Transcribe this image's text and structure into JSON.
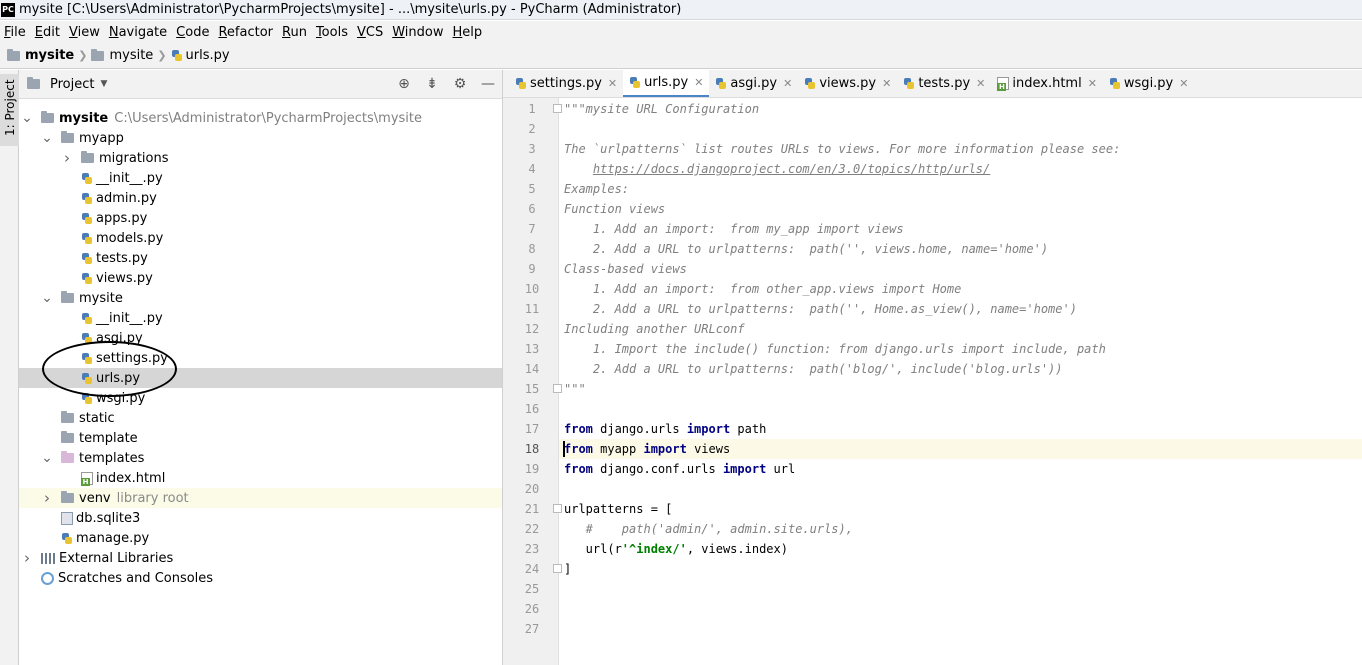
{
  "window": {
    "title": "mysite [C:\\Users\\Administrator\\PycharmProjects\\mysite] - ...\\mysite\\urls.py - PyCharm (Administrator)",
    "logo": "PC"
  },
  "menu": [
    "File",
    "Edit",
    "View",
    "Navigate",
    "Code",
    "Refactor",
    "Run",
    "Tools",
    "VCS",
    "Window",
    "Help"
  ],
  "breadcrumb": [
    "mysite",
    "mysite",
    "urls.py"
  ],
  "toolstrip": {
    "project_tab": "1: Project"
  },
  "project_panel": {
    "title": "Project",
    "tree": [
      {
        "label": "mysite",
        "hint": "C:\\Users\\Administrator\\PycharmProjects\\mysite",
        "bold": true,
        "depth": 0,
        "kind": "folder",
        "expanded": true
      },
      {
        "label": "myapp",
        "depth": 1,
        "kind": "folder",
        "expanded": true
      },
      {
        "label": "migrations",
        "depth": 2,
        "kind": "folder",
        "expanded": false
      },
      {
        "label": "__init__.py",
        "depth": 3,
        "kind": "py"
      },
      {
        "label": "admin.py",
        "depth": 3,
        "kind": "py"
      },
      {
        "label": "apps.py",
        "depth": 3,
        "kind": "py"
      },
      {
        "label": "models.py",
        "depth": 3,
        "kind": "py"
      },
      {
        "label": "tests.py",
        "depth": 3,
        "kind": "py"
      },
      {
        "label": "views.py",
        "depth": 3,
        "kind": "py"
      },
      {
        "label": "mysite",
        "depth": 1,
        "kind": "folder",
        "expanded": true
      },
      {
        "label": "__init__.py",
        "depth": 3,
        "kind": "py"
      },
      {
        "label": "asgi.py",
        "depth": 3,
        "kind": "py"
      },
      {
        "label": "settings.py",
        "depth": 3,
        "kind": "py"
      },
      {
        "label": "urls.py",
        "depth": 3,
        "kind": "py",
        "selected": true
      },
      {
        "label": "wsgi.py",
        "depth": 3,
        "kind": "py"
      },
      {
        "label": "static",
        "depth": 2,
        "kind": "folder"
      },
      {
        "label": "template",
        "depth": 2,
        "kind": "folder"
      },
      {
        "label": "templates",
        "depth": 1,
        "kind": "folder-pink",
        "expanded": true
      },
      {
        "label": "index.html",
        "depth": 3,
        "kind": "html"
      },
      {
        "label": "venv",
        "hint": "library root",
        "depth": 1,
        "kind": "folder",
        "expanded": false,
        "venv": true
      },
      {
        "label": "db.sqlite3",
        "depth": 2,
        "kind": "db"
      },
      {
        "label": "manage.py",
        "depth": 2,
        "kind": "py"
      },
      {
        "label": "External Libraries",
        "depth": 0,
        "kind": "lib",
        "expanded": false
      },
      {
        "label": "Scratches and Consoles",
        "depth": 1,
        "kind": "scratch"
      }
    ]
  },
  "editor": {
    "tabs": [
      {
        "label": "settings.py",
        "kind": "py"
      },
      {
        "label": "urls.py",
        "kind": "py",
        "active": true
      },
      {
        "label": "asgi.py",
        "kind": "py"
      },
      {
        "label": "views.py",
        "kind": "py"
      },
      {
        "label": "tests.py",
        "kind": "py"
      },
      {
        "label": "index.html",
        "kind": "html"
      },
      {
        "label": "wsgi.py",
        "kind": "py"
      }
    ],
    "current_line": 18,
    "lines": [
      [
        {
          "t": "\"\"\"mysite URL Configuration",
          "c": "doc"
        }
      ],
      [],
      [
        {
          "t": "The `urlpatterns` list routes URLs to views. For more information please see:",
          "c": "doc"
        }
      ],
      [
        {
          "t": "    ",
          "c": "doc"
        },
        {
          "t": "https://docs.djangoproject.com/en/3.0/topics/http/urls/",
          "c": "doc-link"
        }
      ],
      [
        {
          "t": "Examples:",
          "c": "doc"
        }
      ],
      [
        {
          "t": "Function views",
          "c": "doc"
        }
      ],
      [
        {
          "t": "    1. Add an import:  from my_app import views",
          "c": "doc"
        }
      ],
      [
        {
          "t": "    2. Add a URL to urlpatterns:  path('', views.home, name='home')",
          "c": "doc"
        }
      ],
      [
        {
          "t": "Class-based views",
          "c": "doc"
        }
      ],
      [
        {
          "t": "    1. Add an import:  from other_app.views import Home",
          "c": "doc"
        }
      ],
      [
        {
          "t": "    2. Add a URL to urlpatterns:  path('', Home.as_view(), name='home')",
          "c": "doc"
        }
      ],
      [
        {
          "t": "Including another URLconf",
          "c": "doc"
        }
      ],
      [
        {
          "t": "    1. Import the include() function: from django.urls import include, path",
          "c": "doc"
        }
      ],
      [
        {
          "t": "    2. Add a URL to urlpatterns:  path('blog/', include('blog.urls'))",
          "c": "doc"
        }
      ],
      [
        {
          "t": "\"\"\"",
          "c": "doc"
        }
      ],
      [],
      [
        {
          "t": "from",
          "c": "kw"
        },
        {
          "t": " django.urls ",
          "c": ""
        },
        {
          "t": "import",
          "c": "kw"
        },
        {
          "t": " path",
          "c": ""
        }
      ],
      [
        {
          "t": "from",
          "c": "kw"
        },
        {
          "t": " myapp ",
          "c": ""
        },
        {
          "t": "import",
          "c": "kw"
        },
        {
          "t": " views",
          "c": ""
        }
      ],
      [
        {
          "t": "from",
          "c": "kw"
        },
        {
          "t": " django.conf.urls ",
          "c": ""
        },
        {
          "t": "import",
          "c": "kw"
        },
        {
          "t": " url",
          "c": ""
        }
      ],
      [],
      [
        {
          "t": "urlpatterns = [",
          "c": ""
        }
      ],
      [
        {
          "t": "   #    path('admin/', admin.site.urls),",
          "c": "com"
        }
      ],
      [
        {
          "t": "   url(r",
          "c": ""
        },
        {
          "t": "'^index/'",
          "c": "str"
        },
        {
          "t": ", views.index)",
          "c": ""
        }
      ],
      [
        {
          "t": "]",
          "c": ""
        }
      ],
      [],
      [],
      []
    ]
  }
}
